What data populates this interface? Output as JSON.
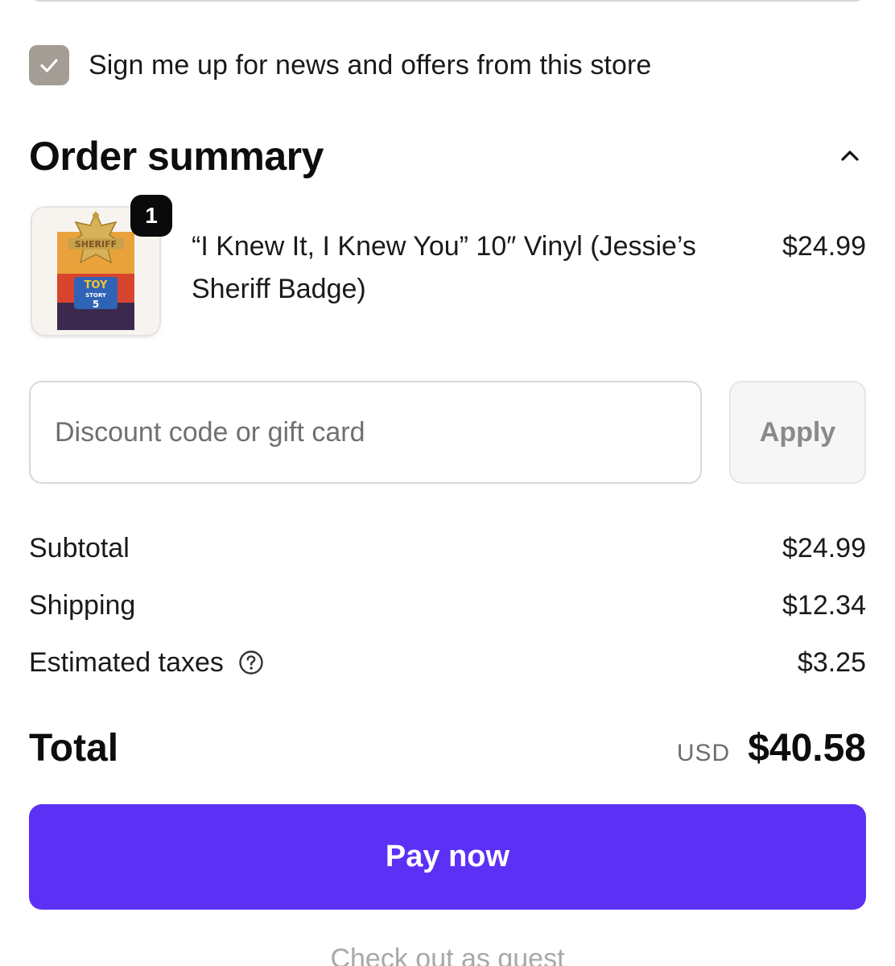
{
  "newsletter": {
    "label": "Sign me up for news and offers from this store",
    "checked": true
  },
  "order_summary": {
    "title": "Order summary",
    "collapse_icon": "chevron-up-icon",
    "items": [
      {
        "name": "“I Knew It, I Knew You” 10″ Vinyl (Jessie’s Sheriff Badge)",
        "price": "$24.99",
        "quantity": "1",
        "thumbnail_lettering": {
          "top": "SHERIFF",
          "logo_line_1": "TOY",
          "logo_line_2": "STORY",
          "logo_number": "5"
        }
      }
    ],
    "discount": {
      "placeholder": "Discount code or gift card",
      "value": "",
      "apply_label": "Apply"
    },
    "lines": {
      "subtotal": {
        "label": "Subtotal",
        "value": "$24.99"
      },
      "shipping": {
        "label": "Shipping",
        "value": "$12.34"
      },
      "taxes": {
        "label": "Estimated taxes",
        "value": "$3.25",
        "icon": "question-circle-icon"
      }
    },
    "total": {
      "label": "Total",
      "currency": "USD",
      "value": "$40.58"
    }
  },
  "actions": {
    "pay_label": "Pay now",
    "guest_label": "Check out as guest"
  },
  "colors": {
    "accent": "#5c31f5",
    "checkbox": "#a39d96",
    "badge": "#0a0a0a"
  }
}
